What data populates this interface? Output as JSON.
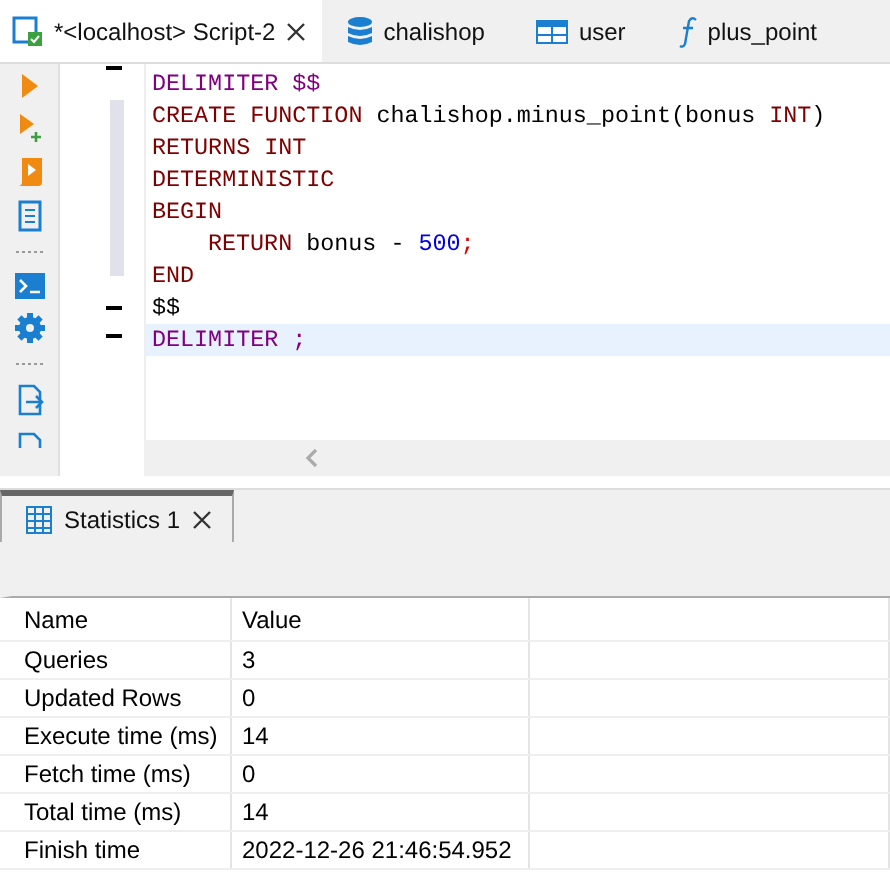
{
  "editor_tabs": [
    {
      "label": "*<localhost> Script-2",
      "kind": "script",
      "selected": true
    },
    {
      "label": "chalishop",
      "kind": "database",
      "selected": false
    },
    {
      "label": "user",
      "kind": "table",
      "selected": false
    },
    {
      "label": "plus_point",
      "kind": "function",
      "selected": false
    }
  ],
  "code_lines": [
    {
      "current": false,
      "indented": false,
      "tokens": [
        {
          "kind": "delim",
          "text": "DELIMITER $$"
        }
      ]
    },
    {
      "current": false,
      "indented": false,
      "tokens": [
        {
          "kind": "kw",
          "text": "CREATE FUNCTION"
        },
        {
          "kind": "plain",
          "text": " chalishop.minus_point(bonus "
        },
        {
          "kind": "kw",
          "text": "INT"
        },
        {
          "kind": "plain",
          "text": ")"
        }
      ]
    },
    {
      "current": false,
      "indented": false,
      "tokens": [
        {
          "kind": "kw",
          "text": "RETURNS INT"
        }
      ]
    },
    {
      "current": false,
      "indented": false,
      "tokens": [
        {
          "kind": "kw",
          "text": "DETERMINISTIC"
        }
      ]
    },
    {
      "current": false,
      "indented": false,
      "tokens": [
        {
          "kind": "kw",
          "text": "BEGIN"
        }
      ]
    },
    {
      "current": false,
      "indented": true,
      "tokens": [
        {
          "kind": "kw",
          "text": "RETURN"
        },
        {
          "kind": "plain",
          "text": " bonus - "
        },
        {
          "kind": "num",
          "text": "500"
        },
        {
          "kind": "punct",
          "text": ";"
        }
      ]
    },
    {
      "current": false,
      "indented": false,
      "tokens": [
        {
          "kind": "kw",
          "text": "END"
        }
      ]
    },
    {
      "current": false,
      "indented": false,
      "tokens": [
        {
          "kind": "plain",
          "text": "$$"
        }
      ]
    },
    {
      "current": true,
      "indented": false,
      "tokens": [
        {
          "kind": "delim",
          "text": "DELIMITER ;"
        }
      ]
    }
  ],
  "result_tabs": [
    {
      "label": "Statistics 1",
      "selected": true
    }
  ],
  "table": {
    "columns": [
      "Name",
      "Value"
    ],
    "rows": [
      [
        "Queries",
        "3"
      ],
      [
        "Updated Rows",
        "0"
      ],
      [
        "Execute time (ms)",
        "14"
      ],
      [
        "Fetch time (ms)",
        "0"
      ],
      [
        "Total time (ms)",
        "14"
      ],
      [
        "Finish time",
        "2022-12-26 21:46:54.952"
      ]
    ]
  }
}
